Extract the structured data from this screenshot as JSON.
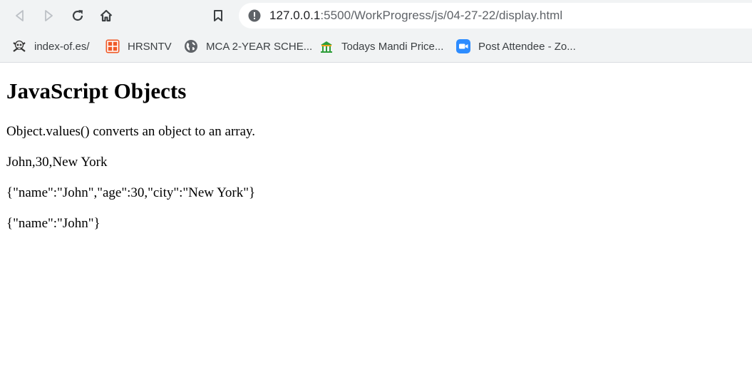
{
  "browser": {
    "url_host": "127.0.0.1",
    "url_rest": ":5500/WorkProgress/js/04-27-22/display.html",
    "bookmarks": [
      {
        "label": "index-of.es/",
        "icon": "skull-crossbones-icon"
      },
      {
        "label": "HRSNTV",
        "icon": "orange-grid-icon"
      },
      {
        "label": "MCA 2-YEAR SCHE...",
        "icon": "globe-icon"
      },
      {
        "label": "Todays Mandi Price...",
        "icon": "market-icon"
      },
      {
        "label": "Post Attendee - Zo...",
        "icon": "zoom-camera-icon"
      }
    ],
    "accent_color": "#5f6368"
  },
  "page": {
    "heading": "JavaScript Objects",
    "paragraphs": [
      "Object.values() converts an object to an array.",
      "John,30,New York",
      "{\"name\":\"John\",\"age\":30,\"city\":\"New York\"}",
      "{\"name\":\"John\"}"
    ]
  }
}
